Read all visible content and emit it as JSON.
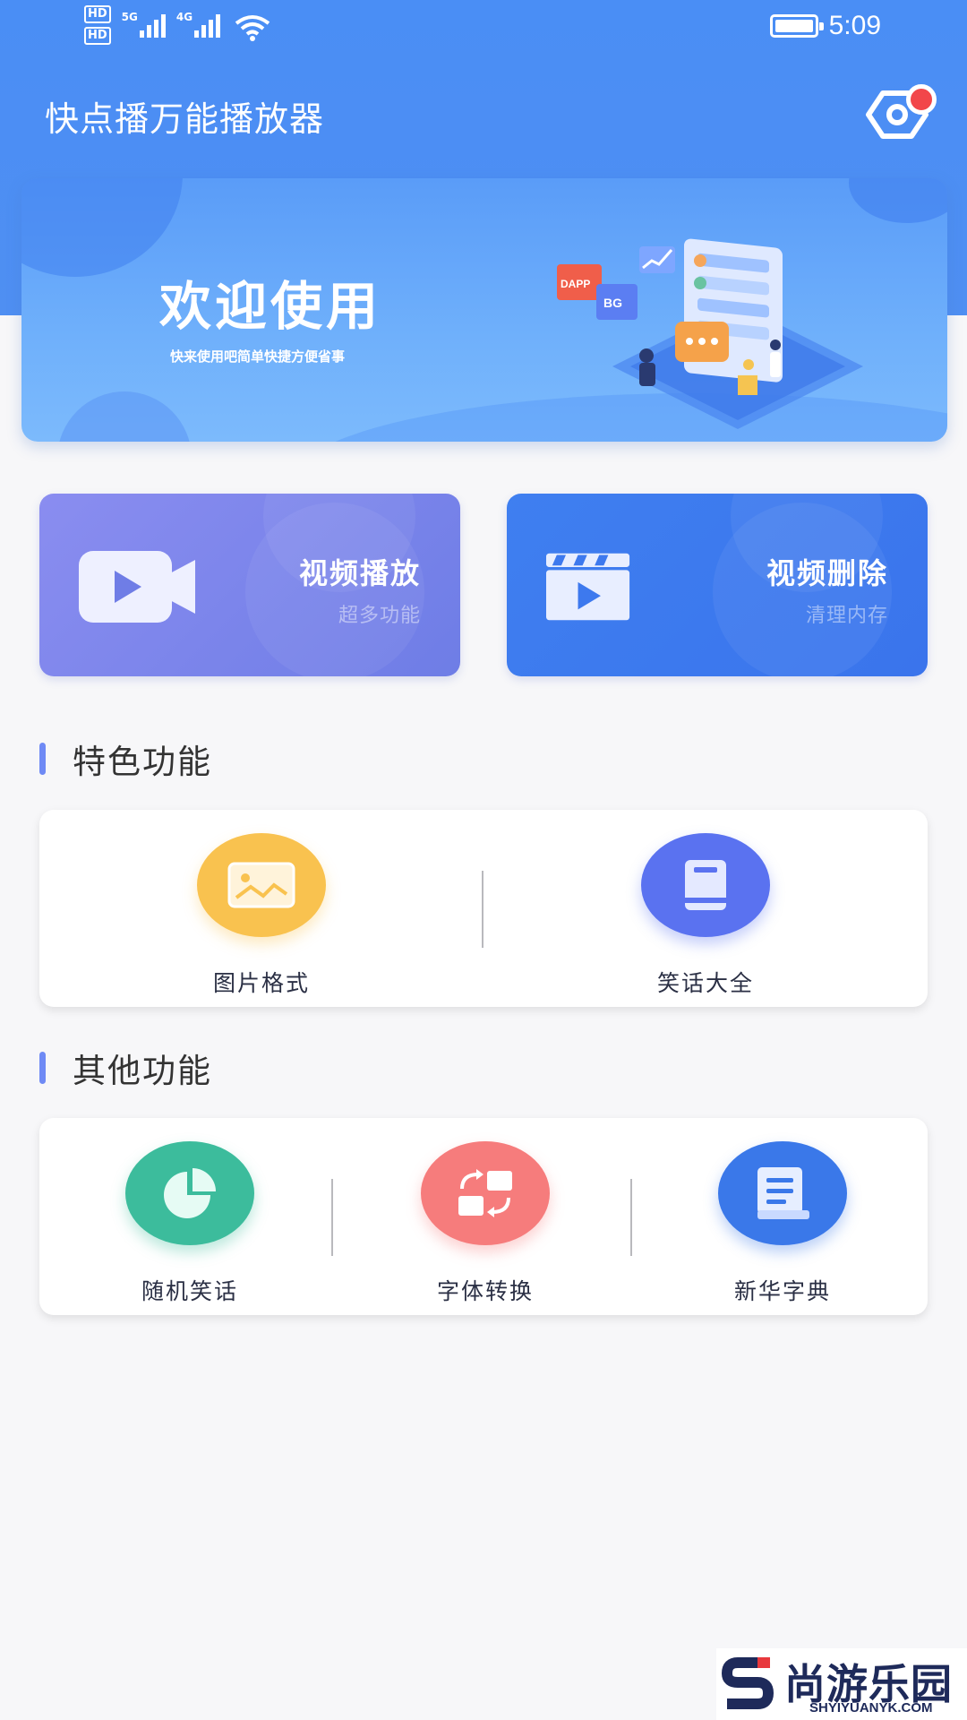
{
  "status_bar": {
    "hd1": "HD",
    "hd2": "HD",
    "net1": "5G",
    "net2": "4G",
    "time": "5:09",
    "battery_level": 1.0
  },
  "header": {
    "title": "快点播万能播放器",
    "settings_icon": "settings-icon",
    "badge_color": "#f2464a",
    "accent": "#4a8ef5"
  },
  "banner": {
    "title": "欢迎使用",
    "subtitle": "快来使用吧简单快捷方便省事",
    "illustration_labels": [
      "DAPP",
      "BG"
    ]
  },
  "quick_actions": [
    {
      "title": "视频播放",
      "subtitle": "超多功能",
      "icon": "video-camera-icon",
      "color": "#7b84ec"
    },
    {
      "title": "视频删除",
      "subtitle": "清理内存",
      "icon": "clapperboard-icon",
      "color": "#3d79ee"
    }
  ],
  "featured": {
    "heading": "特色功能",
    "items": [
      {
        "label": "图片格式",
        "icon": "image-icon",
        "color": "#f9c24f"
      },
      {
        "label": "笑话大全",
        "icon": "book-icon",
        "color": "#5a72f0"
      }
    ]
  },
  "other": {
    "heading": "其他功能",
    "items": [
      {
        "label": "随机笑话",
        "icon": "pie-chart-icon",
        "color": "#3cbc9c"
      },
      {
        "label": "字体转换",
        "icon": "convert-icon",
        "color": "#f67c7c"
      },
      {
        "label": "新华字典",
        "icon": "dictionary-icon",
        "color": "#3a78e9"
      }
    ]
  },
  "watermark": {
    "name": "尚游乐园",
    "url": "SHYIYUANYK.COM"
  }
}
